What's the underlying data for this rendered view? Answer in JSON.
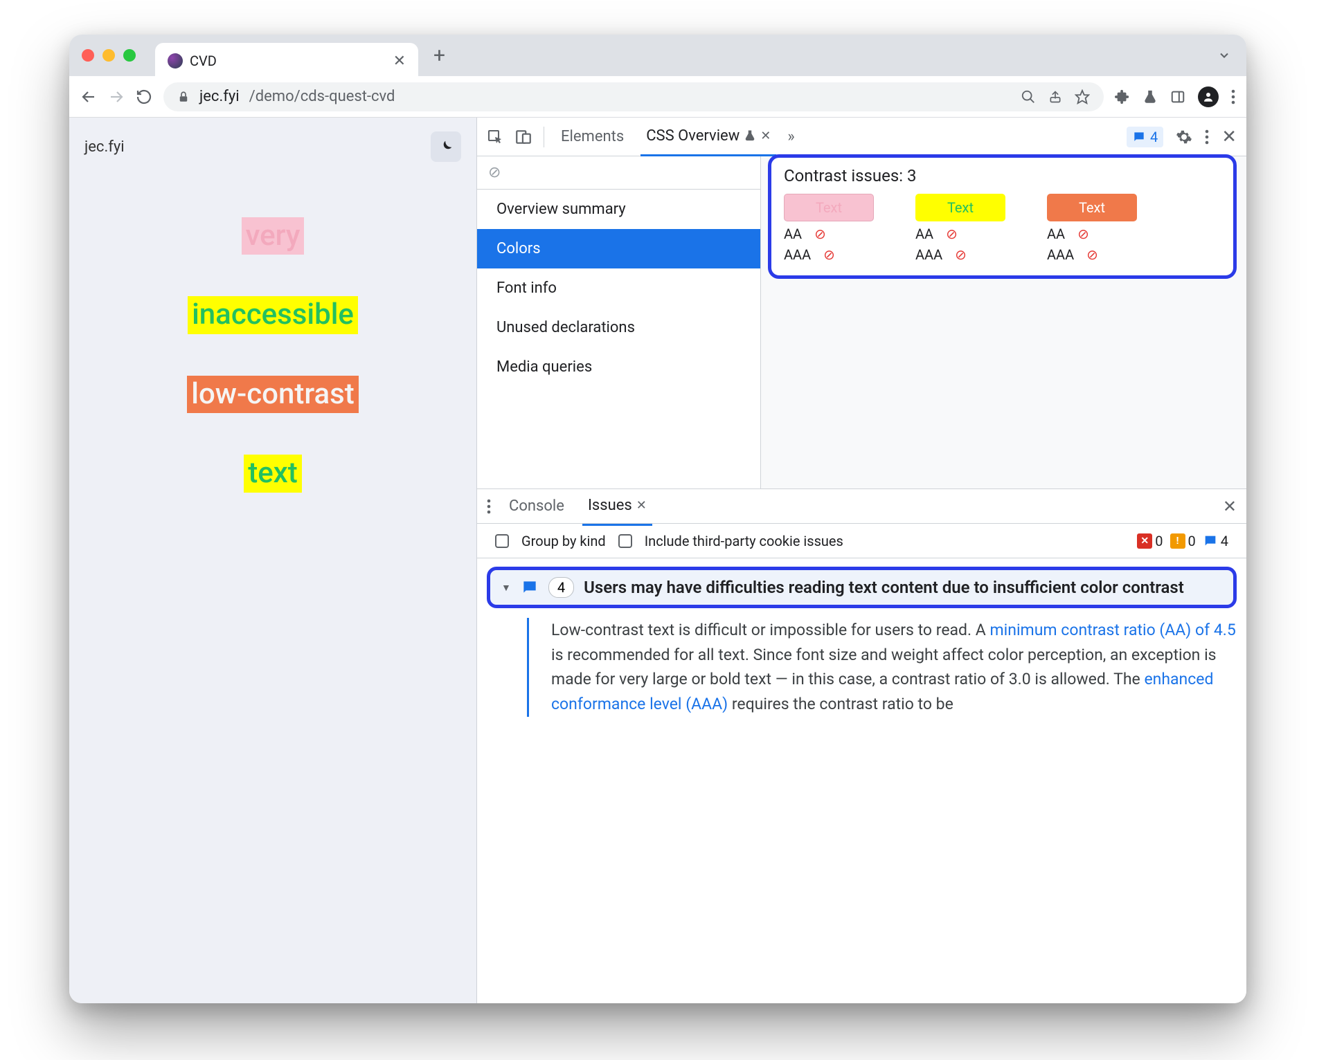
{
  "browser_tab": {
    "title": "CVD"
  },
  "url": {
    "host": "jec.fyi",
    "path": "/demo/cds-quest-cvd"
  },
  "page": {
    "site_name": "jec.fyi",
    "samples": [
      "very",
      "inaccessible",
      "low-contrast",
      "text"
    ]
  },
  "devtools": {
    "tabs": {
      "elements": "Elements",
      "css_overview": "CSS Overview",
      "issues_count": "4"
    },
    "sidebar": {
      "items": [
        "Overview summary",
        "Colors",
        "Font info",
        "Unused declarations",
        "Media queries"
      ],
      "active_index": 1
    },
    "contrast": {
      "title": "Contrast issues: 3",
      "swatch_label": "Text",
      "aa": "AA",
      "aaa": "AAA"
    }
  },
  "drawer": {
    "tabs": {
      "console": "Console",
      "issues": "Issues"
    },
    "filters": {
      "group_by_kind": "Group by kind",
      "third_party": "Include third-party cookie issues",
      "err_count": "0",
      "warn_count": "0",
      "info_count": "4"
    },
    "issue": {
      "count": "4",
      "title": "Users may have difficulties reading text content due to insufficient color contrast",
      "body_pre": "Low-contrast text is difficult or impossible for users to read. A ",
      "link1": "minimum contrast ratio (AA) of 4.5",
      "body_mid": " is recommended for all text. Since font size and weight affect color perception, an exception is made for very large or bold text — in this case, a contrast ratio of 3.0 is allowed. The ",
      "link2": "enhanced conformance level (AAA)",
      "body_post": " requires the contrast ratio to be"
    }
  }
}
